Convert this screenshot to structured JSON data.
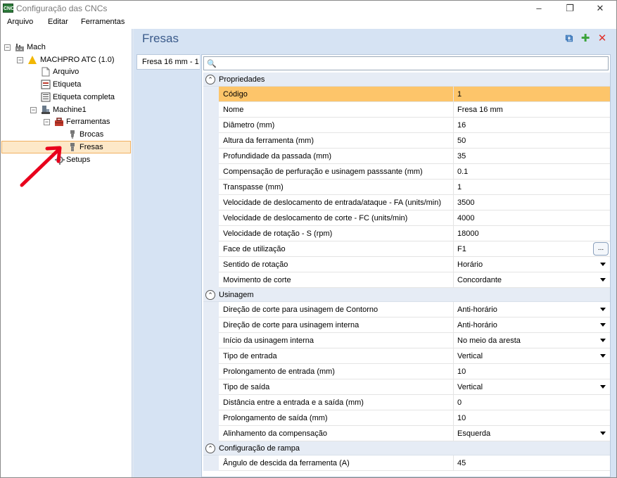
{
  "window": {
    "app_icon_text": "CNC",
    "title": "Configuração das CNCs",
    "minimize": "–",
    "maximize": "❐",
    "close": "✕"
  },
  "menu": [
    "Arquivo",
    "Editar",
    "Ferramentas"
  ],
  "tree": {
    "root": "Mach",
    "machine": "MACHPRO ATC (1.0)",
    "arquivo": "Arquivo",
    "etiqueta": "Etiqueta",
    "etiqueta_completa": "Etiqueta completa",
    "machine1": "Machine1",
    "ferramentas": "Ferramentas",
    "brocas": "Brocas",
    "fresas": "Fresas",
    "setups": "Setups",
    "expand_minus": "−",
    "expand_plus": "+"
  },
  "right": {
    "title": "Fresas",
    "tab_label": "Fresa 16 mm - 1",
    "copy_icon": "⧉",
    "add_icon": "✚",
    "delete_icon": "✕",
    "search_icon": "🔍"
  },
  "grid": {
    "collapse_symbol": "⌃",
    "ellipsis": "...",
    "categories": [
      {
        "name": "Propriedades",
        "rows": [
          {
            "name": "Código",
            "value": "1",
            "highlight": true
          },
          {
            "name": "Nome",
            "value": "Fresa 16 mm"
          },
          {
            "name": "Diâmetro (mm)",
            "value": "16"
          },
          {
            "name": "Altura da ferramenta (mm)",
            "value": "50"
          },
          {
            "name": "Profundidade da passada (mm)",
            "value": "35"
          },
          {
            "name": "Compensação de perfuração e usinagem passsante (mm)",
            "value": "0.1"
          },
          {
            "name": "Transpasse (mm)",
            "value": "1"
          },
          {
            "name": "Velocidade de deslocamento de entrada/ataque - FA (units/min)",
            "value": "3500"
          },
          {
            "name": "Velocidade de deslocamento de corte - FC (units/min)",
            "value": "4000"
          },
          {
            "name": "Velocidade de rotação - S (rpm)",
            "value": "18000"
          },
          {
            "name": "Face de utilização",
            "value": "F1",
            "editor": "ellipsis"
          },
          {
            "name": "Sentido de rotação",
            "value": "Horário",
            "editor": "dropdown"
          },
          {
            "name": "Movimento de corte",
            "value": "Concordante",
            "editor": "dropdown"
          }
        ]
      },
      {
        "name": "Usinagem",
        "rows": [
          {
            "name": "Direção de corte para usinagem de Contorno",
            "value": "Anti-horário",
            "editor": "dropdown"
          },
          {
            "name": "Direção de corte para usinagem interna",
            "value": "Anti-horário",
            "editor": "dropdown"
          },
          {
            "name": "Início da usinagem interna",
            "value": "No meio da aresta",
            "editor": "dropdown"
          },
          {
            "name": "Tipo de entrada",
            "value": "Vertical",
            "editor": "dropdown"
          },
          {
            "name": "Prolongamento de entrada (mm)",
            "value": "10"
          },
          {
            "name": "Tipo de saída",
            "value": "Vertical",
            "editor": "dropdown"
          },
          {
            "name": "Distância entre a entrada e a saída (mm)",
            "value": "0"
          },
          {
            "name": "Prolongamento de saída (mm)",
            "value": "10"
          },
          {
            "name": "Alinhamento da compensação",
            "value": "Esquerda",
            "editor": "dropdown"
          }
        ]
      },
      {
        "name": "Configuração de rampa",
        "rows": [
          {
            "name": "Ângulo de descida da ferramenta (A)",
            "value": "45"
          }
        ]
      }
    ]
  },
  "colors": {
    "accent": "#3a5a8a",
    "selection": "#fdc56a",
    "tree_selection": "#fde8c8",
    "annotation_arrow": "#e8001c"
  }
}
